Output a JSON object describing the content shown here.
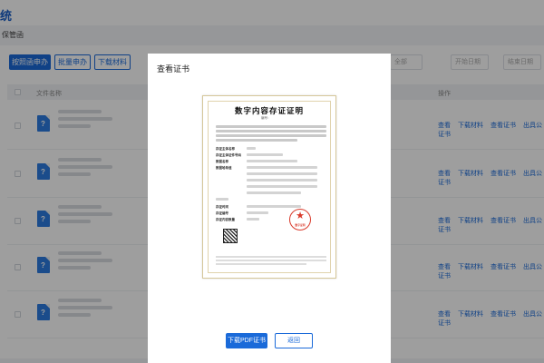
{
  "page": {
    "title": "统",
    "subtitle": "保管函"
  },
  "toolbar": {
    "btn_batch_apply": "按照函申办",
    "btn_batch_process": "批量申办",
    "btn_download": "下载材料",
    "select1": "全部",
    "select2": "开始日期",
    "select3": "结束日期"
  },
  "table": {
    "col_filename": "文件名称",
    "col_actions": "操作",
    "row_count": 5,
    "actions": [
      "查看",
      "下载材料",
      "查看证书",
      "出具公证书"
    ]
  },
  "modal": {
    "title": "查看证书",
    "download_pdf_label": "下载PDF证书",
    "back_label": "返回"
  },
  "certificate": {
    "title": "数字内容存证证明",
    "number_prefix": "编号：",
    "fields": [
      "存证主体名称",
      "存证主体证件号码",
      "数据名称",
      "数据哈希值",
      "存证时间",
      "存证编号",
      "存证内容数量"
    ],
    "seal_text": "数字证明",
    "colors": {
      "seal": "#d93a2b",
      "frame": "#d6c79a"
    }
  },
  "colors": {
    "primary": "#1a6ad9",
    "overlay": "rgba(0,0,0,0.38)"
  }
}
